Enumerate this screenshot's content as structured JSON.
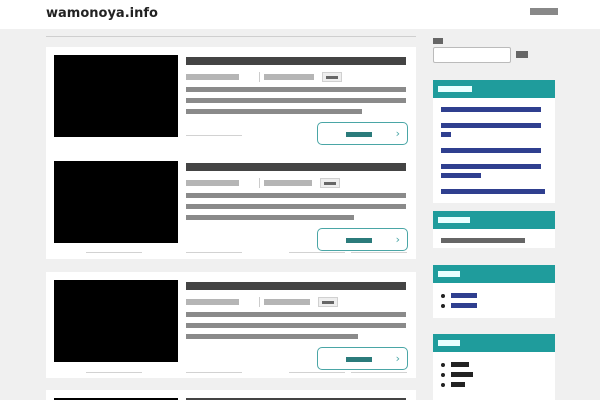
{
  "header": {
    "site_title": "wamonoya.info",
    "right_link": ""
  },
  "posts": [
    {
      "title": "",
      "posted": "",
      "updated": "",
      "category": "",
      "excerpt": "",
      "read_more": ""
    },
    {
      "title": "",
      "posted": "",
      "updated": "",
      "category": "",
      "excerpt": "",
      "read_more": ""
    },
    {
      "title": "",
      "posted": "",
      "updated": "",
      "category": "",
      "excerpt": "",
      "read_more": ""
    }
  ],
  "sidebar": {
    "search_label": "",
    "search_button": "",
    "recent_posts": {
      "heading": "",
      "items": [
        "",
        "",
        "",
        "",
        ""
      ]
    },
    "recent_comments": {
      "heading": "",
      "text": ""
    },
    "archives": {
      "heading": "",
      "items": [
        "",
        ""
      ]
    },
    "categories": {
      "heading": "",
      "items": [
        "",
        "",
        ""
      ]
    }
  },
  "colors": {
    "accent": "#1f9c9c",
    "link": "#2f3f8f",
    "button_border": "#4aa6a6"
  }
}
